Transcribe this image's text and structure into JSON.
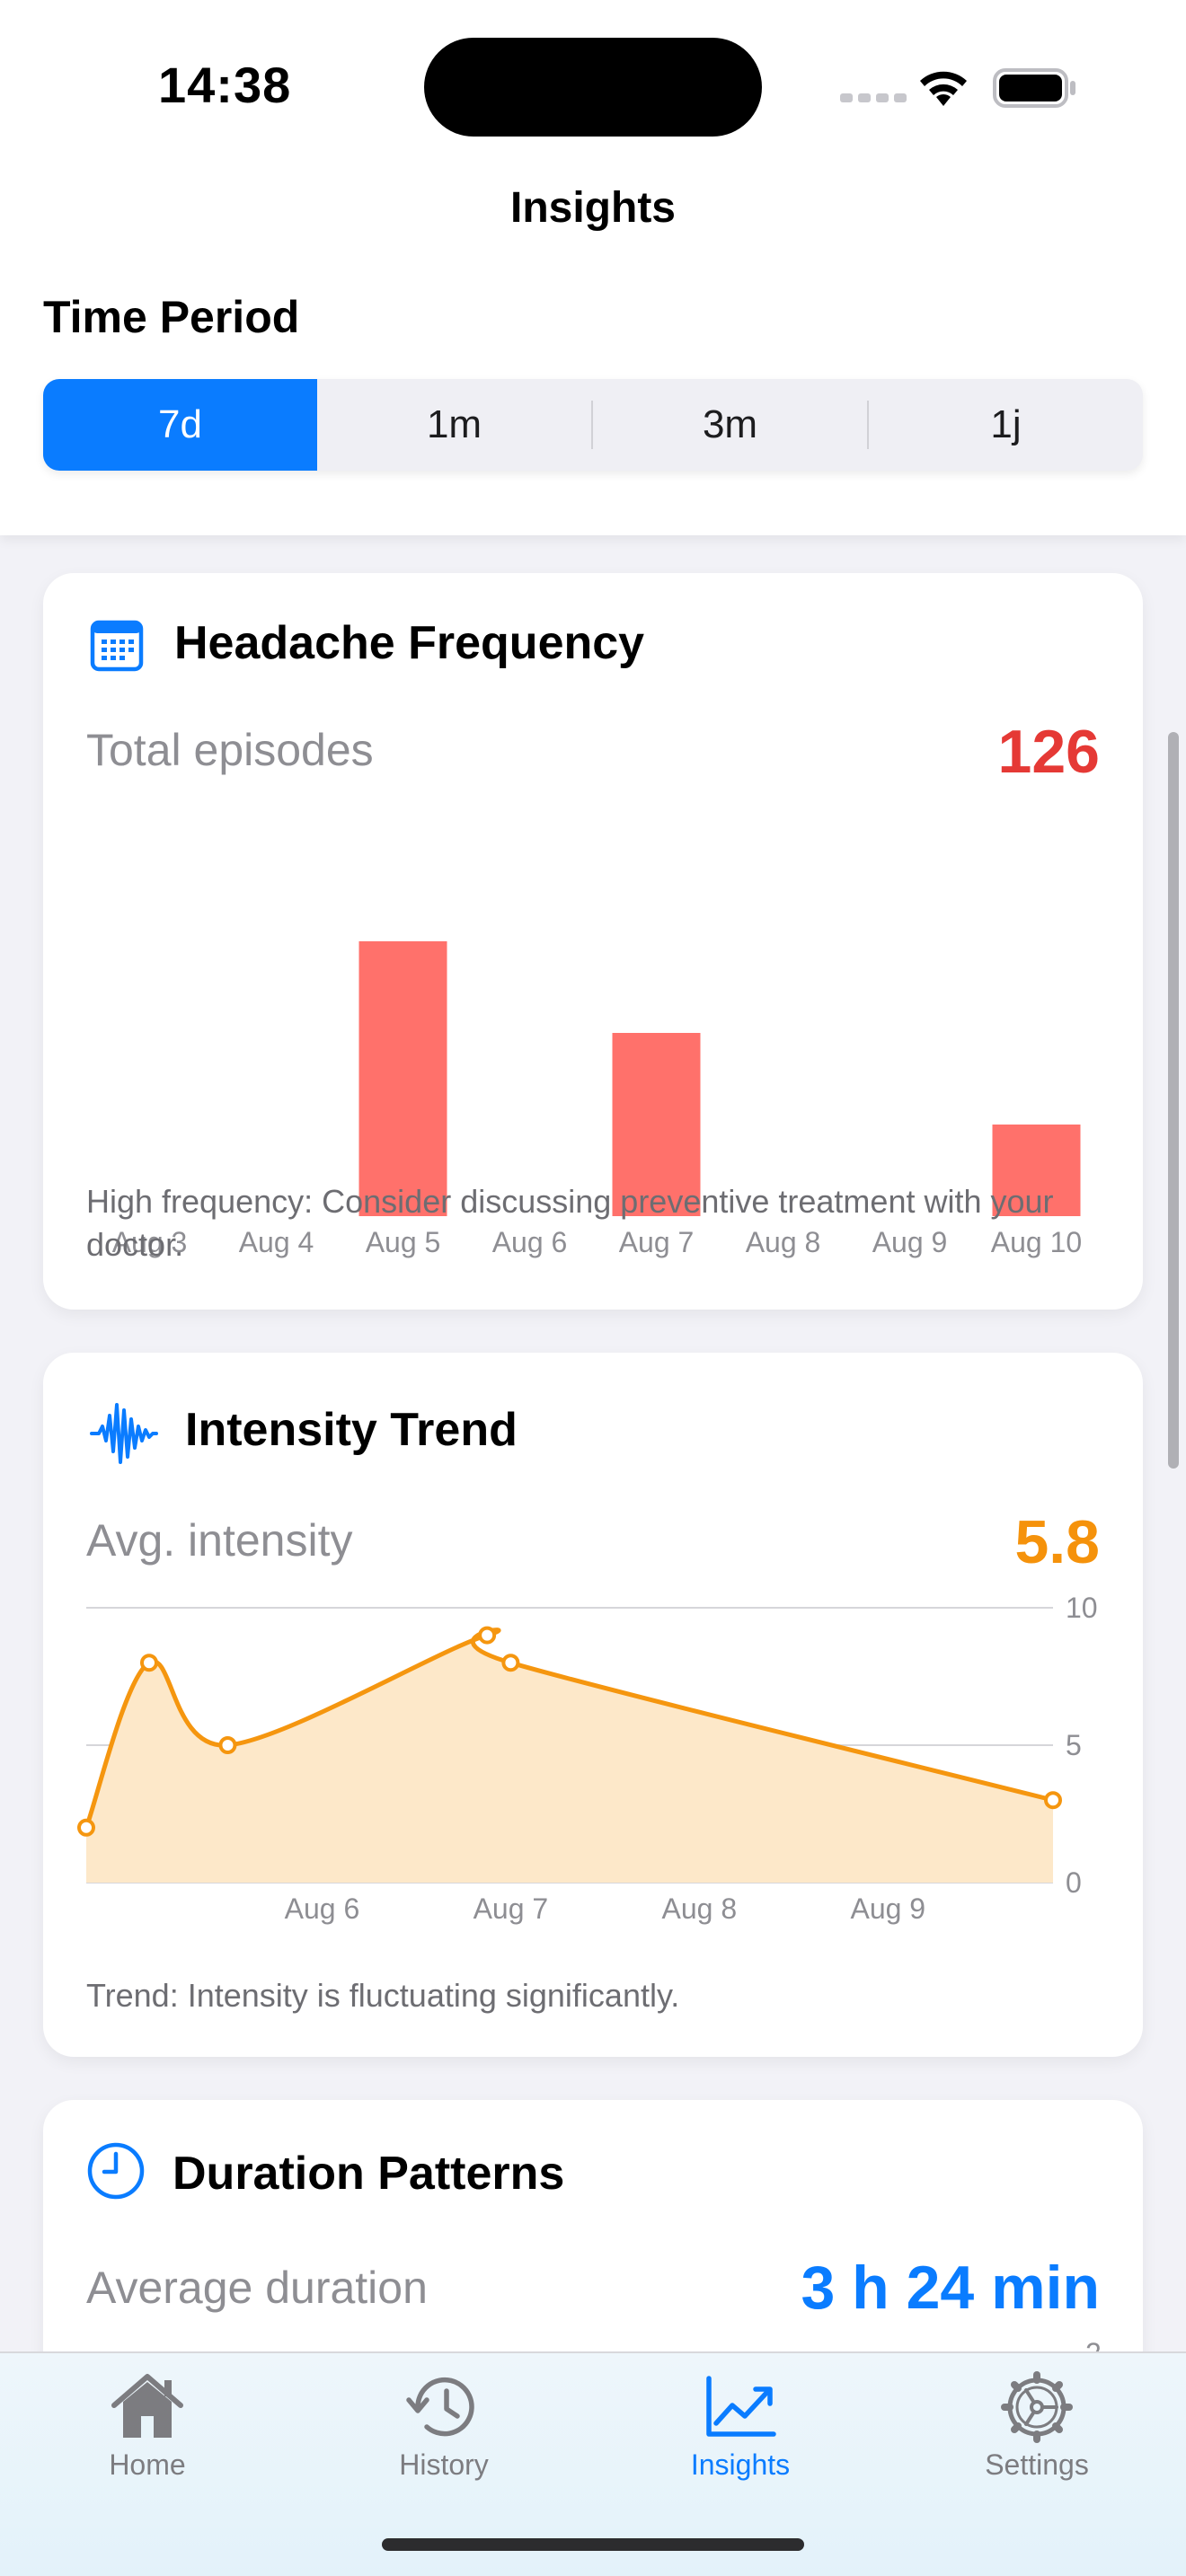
{
  "status_bar": {
    "time": "14:38"
  },
  "header": {
    "title": "Insights",
    "section_label": "Time Period",
    "segments": [
      {
        "label": "7d",
        "active": true
      },
      {
        "label": "1m",
        "active": false
      },
      {
        "label": "3m",
        "active": false
      },
      {
        "label": "1j",
        "active": false
      }
    ]
  },
  "frequency_card": {
    "icon": "calendar-icon",
    "title": "Headache Frequency",
    "metric_label": "Total episodes",
    "metric_value": "126",
    "metric_color": "#e53935",
    "note": "High frequency: Consider discussing preventive treatment with your doctor."
  },
  "intensity_card": {
    "icon": "waveform-icon",
    "title": "Intensity Trend",
    "metric_label": "Avg. intensity",
    "metric_value": "5.8",
    "metric_color": "#f5920b",
    "note": "Trend: Intensity is fluctuating significantly."
  },
  "duration_card": {
    "icon": "clock-icon",
    "title": "Duration Patterns",
    "metric_label": "Average duration",
    "metric_value": "3 h 24 min",
    "metric_color": "#0a7cff",
    "partial_tick": "2"
  },
  "chart_data": [
    {
      "type": "bar",
      "categories": [
        "Aug 3",
        "Aug 4",
        "Aug 5",
        "Aug 6",
        "Aug 7",
        "Aug 8",
        "Aug 9",
        "Aug 10"
      ],
      "values": [
        0,
        0,
        60,
        0,
        40,
        0,
        0,
        20
      ],
      "color": "#ff716b",
      "ylim": [
        0,
        60
      ]
    },
    {
      "type": "area",
      "series": [
        {
          "values": [
            {
              "x": "2024-08-04T18:00",
              "y": 2
            },
            {
              "x": "2024-08-05T02:00",
              "y": 8
            },
            {
              "x": "2024-08-05T12:00",
              "y": 5
            },
            {
              "x": "2024-08-06T21:00",
              "y": 9
            },
            {
              "x": "2024-08-07T00:00",
              "y": 8
            },
            {
              "x": "2024-08-09T21:00",
              "y": 3
            }
          ]
        }
      ],
      "x_ticks": [
        "Aug 6",
        "Aug 7",
        "Aug 8",
        "Aug 9"
      ],
      "y_ticks": [
        "0",
        "5",
        "10"
      ],
      "ylim": [
        0,
        10
      ],
      "line_color": "#f5960f",
      "fill_color": "#fde8c9",
      "grid": true
    }
  ],
  "tab_bar": {
    "tabs": [
      {
        "label": "Home",
        "icon": "house-icon",
        "active": false
      },
      {
        "label": "History",
        "icon": "clock-arrow-icon",
        "active": false
      },
      {
        "label": "Insights",
        "icon": "chart-trend-icon",
        "active": true
      },
      {
        "label": "Settings",
        "icon": "gear-icon",
        "active": false
      }
    ]
  }
}
